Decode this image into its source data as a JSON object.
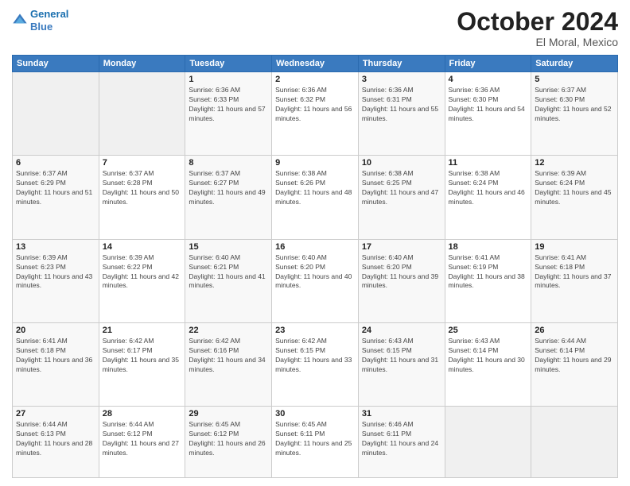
{
  "header": {
    "logo_line1": "General",
    "logo_line2": "Blue",
    "month": "October 2024",
    "location": "El Moral, Mexico"
  },
  "days_of_week": [
    "Sunday",
    "Monday",
    "Tuesday",
    "Wednesday",
    "Thursday",
    "Friday",
    "Saturday"
  ],
  "weeks": [
    [
      {
        "day": "",
        "sunrise": "",
        "sunset": "",
        "daylight": ""
      },
      {
        "day": "",
        "sunrise": "",
        "sunset": "",
        "daylight": ""
      },
      {
        "day": "1",
        "sunrise": "Sunrise: 6:36 AM",
        "sunset": "Sunset: 6:33 PM",
        "daylight": "Daylight: 11 hours and 57 minutes."
      },
      {
        "day": "2",
        "sunrise": "Sunrise: 6:36 AM",
        "sunset": "Sunset: 6:32 PM",
        "daylight": "Daylight: 11 hours and 56 minutes."
      },
      {
        "day": "3",
        "sunrise": "Sunrise: 6:36 AM",
        "sunset": "Sunset: 6:31 PM",
        "daylight": "Daylight: 11 hours and 55 minutes."
      },
      {
        "day": "4",
        "sunrise": "Sunrise: 6:36 AM",
        "sunset": "Sunset: 6:30 PM",
        "daylight": "Daylight: 11 hours and 54 minutes."
      },
      {
        "day": "5",
        "sunrise": "Sunrise: 6:37 AM",
        "sunset": "Sunset: 6:30 PM",
        "daylight": "Daylight: 11 hours and 52 minutes."
      }
    ],
    [
      {
        "day": "6",
        "sunrise": "Sunrise: 6:37 AM",
        "sunset": "Sunset: 6:29 PM",
        "daylight": "Daylight: 11 hours and 51 minutes."
      },
      {
        "day": "7",
        "sunrise": "Sunrise: 6:37 AM",
        "sunset": "Sunset: 6:28 PM",
        "daylight": "Daylight: 11 hours and 50 minutes."
      },
      {
        "day": "8",
        "sunrise": "Sunrise: 6:37 AM",
        "sunset": "Sunset: 6:27 PM",
        "daylight": "Daylight: 11 hours and 49 minutes."
      },
      {
        "day": "9",
        "sunrise": "Sunrise: 6:38 AM",
        "sunset": "Sunset: 6:26 PM",
        "daylight": "Daylight: 11 hours and 48 minutes."
      },
      {
        "day": "10",
        "sunrise": "Sunrise: 6:38 AM",
        "sunset": "Sunset: 6:25 PM",
        "daylight": "Daylight: 11 hours and 47 minutes."
      },
      {
        "day": "11",
        "sunrise": "Sunrise: 6:38 AM",
        "sunset": "Sunset: 6:24 PM",
        "daylight": "Daylight: 11 hours and 46 minutes."
      },
      {
        "day": "12",
        "sunrise": "Sunrise: 6:39 AM",
        "sunset": "Sunset: 6:24 PM",
        "daylight": "Daylight: 11 hours and 45 minutes."
      }
    ],
    [
      {
        "day": "13",
        "sunrise": "Sunrise: 6:39 AM",
        "sunset": "Sunset: 6:23 PM",
        "daylight": "Daylight: 11 hours and 43 minutes."
      },
      {
        "day": "14",
        "sunrise": "Sunrise: 6:39 AM",
        "sunset": "Sunset: 6:22 PM",
        "daylight": "Daylight: 11 hours and 42 minutes."
      },
      {
        "day": "15",
        "sunrise": "Sunrise: 6:40 AM",
        "sunset": "Sunset: 6:21 PM",
        "daylight": "Daylight: 11 hours and 41 minutes."
      },
      {
        "day": "16",
        "sunrise": "Sunrise: 6:40 AM",
        "sunset": "Sunset: 6:20 PM",
        "daylight": "Daylight: 11 hours and 40 minutes."
      },
      {
        "day": "17",
        "sunrise": "Sunrise: 6:40 AM",
        "sunset": "Sunset: 6:20 PM",
        "daylight": "Daylight: 11 hours and 39 minutes."
      },
      {
        "day": "18",
        "sunrise": "Sunrise: 6:41 AM",
        "sunset": "Sunset: 6:19 PM",
        "daylight": "Daylight: 11 hours and 38 minutes."
      },
      {
        "day": "19",
        "sunrise": "Sunrise: 6:41 AM",
        "sunset": "Sunset: 6:18 PM",
        "daylight": "Daylight: 11 hours and 37 minutes."
      }
    ],
    [
      {
        "day": "20",
        "sunrise": "Sunrise: 6:41 AM",
        "sunset": "Sunset: 6:18 PM",
        "daylight": "Daylight: 11 hours and 36 minutes."
      },
      {
        "day": "21",
        "sunrise": "Sunrise: 6:42 AM",
        "sunset": "Sunset: 6:17 PM",
        "daylight": "Daylight: 11 hours and 35 minutes."
      },
      {
        "day": "22",
        "sunrise": "Sunrise: 6:42 AM",
        "sunset": "Sunset: 6:16 PM",
        "daylight": "Daylight: 11 hours and 34 minutes."
      },
      {
        "day": "23",
        "sunrise": "Sunrise: 6:42 AM",
        "sunset": "Sunset: 6:15 PM",
        "daylight": "Daylight: 11 hours and 33 minutes."
      },
      {
        "day": "24",
        "sunrise": "Sunrise: 6:43 AM",
        "sunset": "Sunset: 6:15 PM",
        "daylight": "Daylight: 11 hours and 31 minutes."
      },
      {
        "day": "25",
        "sunrise": "Sunrise: 6:43 AM",
        "sunset": "Sunset: 6:14 PM",
        "daylight": "Daylight: 11 hours and 30 minutes."
      },
      {
        "day": "26",
        "sunrise": "Sunrise: 6:44 AM",
        "sunset": "Sunset: 6:14 PM",
        "daylight": "Daylight: 11 hours and 29 minutes."
      }
    ],
    [
      {
        "day": "27",
        "sunrise": "Sunrise: 6:44 AM",
        "sunset": "Sunset: 6:13 PM",
        "daylight": "Daylight: 11 hours and 28 minutes."
      },
      {
        "day": "28",
        "sunrise": "Sunrise: 6:44 AM",
        "sunset": "Sunset: 6:12 PM",
        "daylight": "Daylight: 11 hours and 27 minutes."
      },
      {
        "day": "29",
        "sunrise": "Sunrise: 6:45 AM",
        "sunset": "Sunset: 6:12 PM",
        "daylight": "Daylight: 11 hours and 26 minutes."
      },
      {
        "day": "30",
        "sunrise": "Sunrise: 6:45 AM",
        "sunset": "Sunset: 6:11 PM",
        "daylight": "Daylight: 11 hours and 25 minutes."
      },
      {
        "day": "31",
        "sunrise": "Sunrise: 6:46 AM",
        "sunset": "Sunset: 6:11 PM",
        "daylight": "Daylight: 11 hours and 24 minutes."
      },
      {
        "day": "",
        "sunrise": "",
        "sunset": "",
        "daylight": ""
      },
      {
        "day": "",
        "sunrise": "",
        "sunset": "",
        "daylight": ""
      }
    ]
  ]
}
